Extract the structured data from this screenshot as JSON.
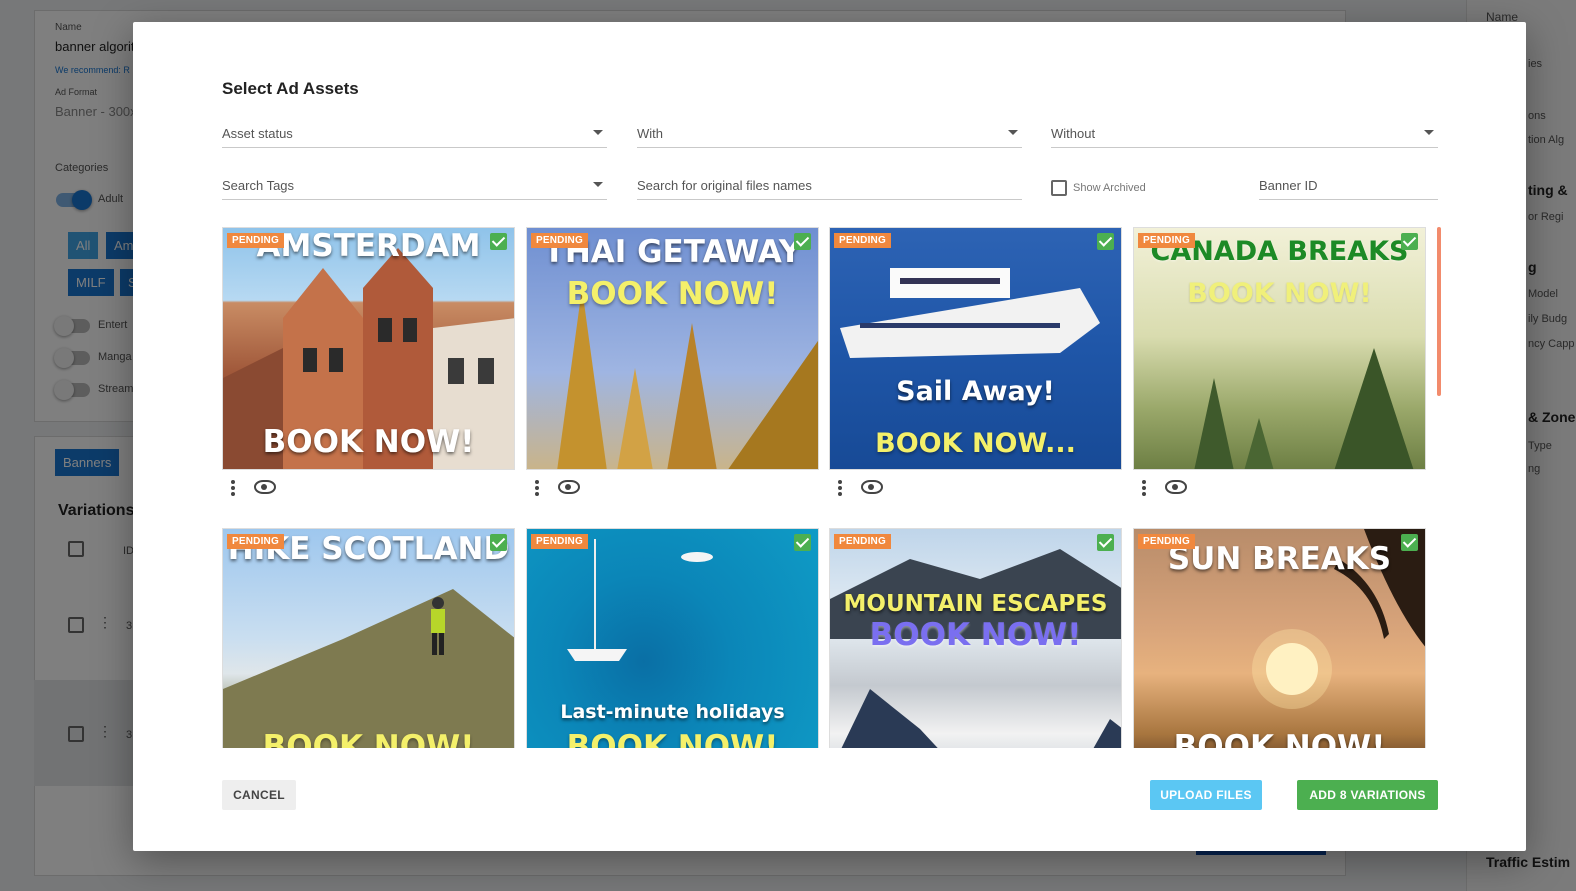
{
  "background": {
    "name_label": "Name",
    "name_value": "banner algorith",
    "recommend_text": "We recommend: R",
    "ad_format_label": "Ad Format",
    "ad_format_value": "Banner - 300x",
    "categories_label": "Categories",
    "toggle_adult": "Adult",
    "category_buttons": [
      "All",
      "Am",
      "MILF",
      "S"
    ],
    "toggles": [
      "Entert",
      "Manga",
      "Stream"
    ],
    "banners_button": "Banners",
    "variations_heading": "Variations",
    "id_header": "ID",
    "row_ids": [
      "3",
      "3"
    ],
    "right_panel": [
      "Name",
      "ies",
      "ons",
      "tion Alg",
      "ting &",
      "or Regi",
      "g",
      "Model",
      "ily Budg",
      "ncy Capp",
      "& Zone",
      "Type",
      "ng",
      "Traffic Estim"
    ]
  },
  "modal": {
    "title": "Select Ad Assets",
    "filters": {
      "asset_status": "Asset status",
      "with": "With",
      "without": "Without",
      "search_tags": "Search Tags",
      "search_files": "Search for original files names",
      "show_archived": "Show Archived",
      "banner_id": "Banner ID"
    },
    "assets": [
      {
        "badge": "PENDING",
        "line1": "AMSTERDAM",
        "line2": "BOOK NOW!"
      },
      {
        "badge": "PENDING",
        "line1": "THAI GETAWAY",
        "line2": "BOOK NOW!"
      },
      {
        "badge": "PENDING",
        "line1": "Sail Away!",
        "line2": "BOOK NOW..."
      },
      {
        "badge": "PENDING",
        "line1": "CANADA BREAKS",
        "line2": "BOOK NOW!"
      },
      {
        "badge": "PENDING",
        "line1": "HIKE SCOTLAND",
        "line2": "BOOK NOW!"
      },
      {
        "badge": "PENDING",
        "line1": "Last-minute holidays",
        "line2": "BOOK NOW!"
      },
      {
        "badge": "PENDING",
        "line1": "MOUNTAIN ESCAPES",
        "line2": "BOOK NOW!"
      },
      {
        "badge": "PENDING",
        "line1": "SUN BREAKS",
        "line2": "BOOK NOW!"
      }
    ],
    "buttons": {
      "cancel": "CANCEL",
      "upload": "UPLOAD FILES",
      "add": "ADD 8 VARIATIONS"
    }
  },
  "colors": {
    "pending_badge": "#f0883e",
    "selected_check": "#4caf50",
    "upload_button": "#5bc7f3",
    "add_button": "#4caf50"
  }
}
